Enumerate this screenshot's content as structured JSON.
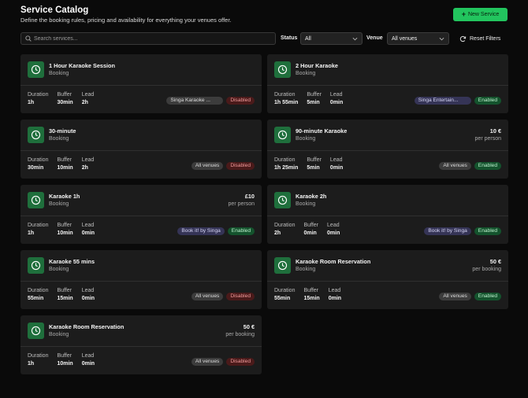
{
  "header": {
    "title": "Service Catalog",
    "subtitle": "Define the booking rules, pricing and availability for everything your venues offer.",
    "new_button": "New Service"
  },
  "filters": {
    "search_placeholder": "Search services...",
    "status_label": "Status",
    "status_value": "All",
    "venue_label": "Venue",
    "venue_value": "All venues",
    "reset_label": "Reset Filters"
  },
  "stat_labels": {
    "duration": "Duration",
    "buffer": "Buffer",
    "lead": "Lead"
  },
  "services": [
    {
      "name": "1 Hour Karaoke Session",
      "kind": "Booking",
      "price": "",
      "unit": "",
      "duration": "1h",
      "buffer": "30min",
      "lead": "2h",
      "venue": "Singa Karaoke ...",
      "status": "Disabled"
    },
    {
      "name": "2 Hour Karaoke",
      "kind": "Booking",
      "price": "",
      "unit": "",
      "duration": "1h 55min",
      "buffer": "5min",
      "lead": "0min",
      "venue": "Singa Entertain...",
      "status": "Enabled"
    },
    {
      "name": "30-minute",
      "kind": "Booking",
      "price": "",
      "unit": "",
      "duration": "30min",
      "buffer": "10min",
      "lead": "2h",
      "venue": "All venues",
      "status": "Disabled"
    },
    {
      "name": "90-minute Karaoke",
      "kind": "Booking",
      "price": "10 €",
      "unit": "per person",
      "duration": "1h 25min",
      "buffer": "5min",
      "lead": "0min",
      "venue": "All venues",
      "status": "Enabled"
    },
    {
      "name": "Karaoke 1h",
      "kind": "Booking",
      "price": "£10",
      "unit": "per person",
      "duration": "1h",
      "buffer": "10min",
      "lead": "0min",
      "venue": "Book it! by Singa",
      "status": "Enabled"
    },
    {
      "name": "Karaoke 2h",
      "kind": "Booking",
      "price": "",
      "unit": "",
      "duration": "2h",
      "buffer": "0min",
      "lead": "0min",
      "venue": "Book it! by Singa",
      "status": "Enabled"
    },
    {
      "name": "Karaoke 55 mins",
      "kind": "Booking",
      "price": "",
      "unit": "",
      "duration": "55min",
      "buffer": "15min",
      "lead": "0min",
      "venue": "All venues",
      "status": "Disabled"
    },
    {
      "name": "Karaoke Room Reservation",
      "kind": "Booking",
      "price": "50 €",
      "unit": "per booking",
      "duration": "55min",
      "buffer": "15min",
      "lead": "0min",
      "venue": "All venues",
      "status": "Enabled"
    },
    {
      "name": "Karaoke Room Reservation",
      "kind": "Booking",
      "price": "50 €",
      "unit": "per booking",
      "duration": "1h",
      "buffer": "10min",
      "lead": "0min",
      "venue": "All venues",
      "status": "Disabled"
    }
  ],
  "colors": {
    "accent": "#22c55e",
    "icon_bg": "#1f6f3c",
    "card_bg": "#1c1c1c",
    "page_bg": "#0a0a0a"
  },
  "icons": {
    "service": "clock-icon",
    "search": "search-icon",
    "reset": "refresh-icon",
    "new": "plus-icon",
    "select": "chevron-down-icon"
  }
}
